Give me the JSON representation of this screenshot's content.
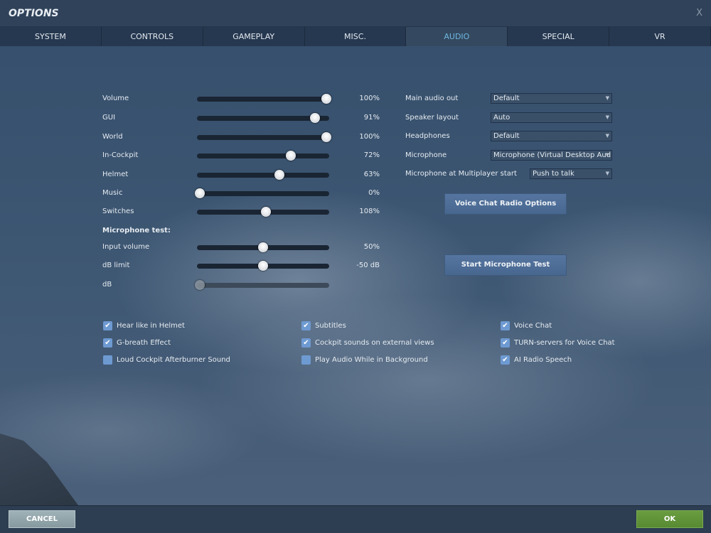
{
  "window": {
    "title": "OPTIONS",
    "close_label": "X"
  },
  "tabs": [
    {
      "label": "SYSTEM"
    },
    {
      "label": "CONTROLS"
    },
    {
      "label": "GAMEPLAY"
    },
    {
      "label": "MISC."
    },
    {
      "label": "AUDIO",
      "active": true
    },
    {
      "label": "SPECIAL"
    },
    {
      "label": "VR"
    }
  ],
  "sliders": [
    {
      "label": "Volume",
      "value": "100%",
      "level": 1.0
    },
    {
      "label": "GUI",
      "value": "91%",
      "level": 0.91
    },
    {
      "label": "World",
      "value": "100%",
      "level": 1.0
    },
    {
      "label": "In-Cockpit",
      "value": "72%",
      "level": 0.72
    },
    {
      "label": "Helmet",
      "value": "63%",
      "level": 0.63
    },
    {
      "label": "Music",
      "value": "0%",
      "level": 0.0
    },
    {
      "label": "Switches",
      "value": "108%",
      "level": 0.52
    }
  ],
  "mic_test": {
    "heading": "Microphone test:",
    "sliders": [
      {
        "label": "Input volume",
        "value": "50%",
        "level": 0.5
      },
      {
        "label": "dB limit",
        "value": "-50 dB",
        "level": 0.5
      },
      {
        "label": "dB",
        "value": "",
        "level": 0.0,
        "disabled": true
      }
    ]
  },
  "dropdowns": [
    {
      "label": "Main audio out",
      "value": "Default"
    },
    {
      "label": "Speaker layout",
      "value": "Auto"
    },
    {
      "label": "Headphones",
      "value": "Default"
    },
    {
      "label": "Microphone",
      "value": "Microphone (Virtual Desktop Audio"
    },
    {
      "label": "Microphone at Multiplayer start",
      "value": "Push to talk"
    }
  ],
  "buttons": {
    "voice_chat": "Voice Chat Radio Options",
    "mic_test": "Start Microphone Test",
    "cancel": "CANCEL",
    "ok": "OK"
  },
  "checkboxes": [
    [
      {
        "label": "Hear like in Helmet",
        "checked": true
      },
      {
        "label": "G-breath Effect",
        "checked": true
      },
      {
        "label": "Loud Cockpit Afterburner Sound",
        "checked": false
      }
    ],
    [
      {
        "label": "Subtitles",
        "checked": true
      },
      {
        "label": "Cockpit sounds on external views",
        "checked": true
      },
      {
        "label": "Play Audio While in Background",
        "checked": false
      }
    ],
    [
      {
        "label": "Voice Chat",
        "checked": true
      },
      {
        "label": "TURN-servers for Voice Chat",
        "checked": true
      },
      {
        "label": "AI Radio Speech",
        "checked": true
      }
    ]
  ],
  "colors": {
    "accent": "#6fb7e0",
    "ok": "#5f8f3a",
    "cancel": "#8fa3aa",
    "checkbox": "#6e9ad2"
  }
}
